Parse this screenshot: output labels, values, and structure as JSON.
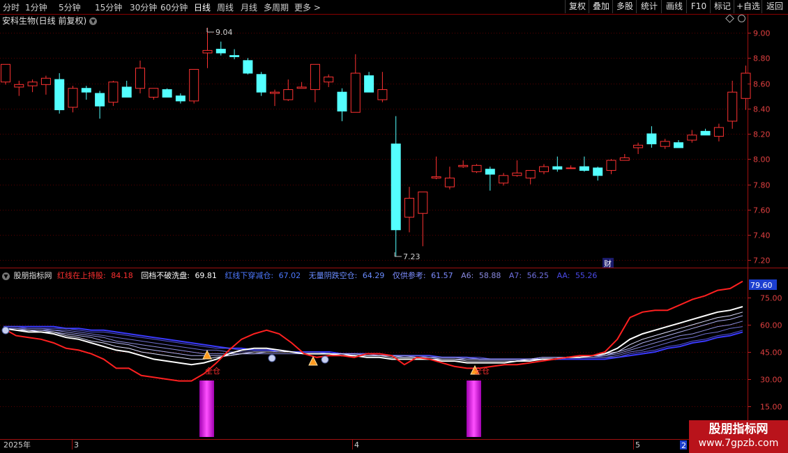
{
  "toolbar": {
    "tabs": [
      "分时",
      "1分钟",
      "5分钟",
      "15分钟",
      "30分钟",
      "60分钟",
      "日线",
      "周线",
      "月线",
      "多周期",
      "更多"
    ],
    "active": "日线",
    "right": [
      "复权",
      "叠加",
      "多股",
      "统计",
      "画线",
      "F10",
      "标记",
      "+自选",
      "返回"
    ]
  },
  "stock": {
    "name": "安科生物(日线 前复权)"
  },
  "price_axis": {
    "ticks": [
      "9.00",
      "8.80",
      "8.60",
      "8.40",
      "8.20",
      "8.00",
      "7.80",
      "7.60",
      "7.40",
      "7.20"
    ]
  },
  "annotations": {
    "high": "9.04",
    "low": "7.23",
    "cai": "财"
  },
  "indicator": {
    "name": "股朋指标网",
    "items": [
      {
        "label": "红线在上持股:",
        "value": "84.18",
        "color": "#ff3030"
      },
      {
        "label": "回档不破洗盘:",
        "value": "69.81",
        "color": "#ffffff"
      },
      {
        "label": "红线下穿减仓:",
        "value": "67.02",
        "color": "#4d79ff"
      },
      {
        "label": "无量阴跌空仓:",
        "value": "64.29",
        "color": "#6a8cff"
      },
      {
        "label": "仅供参考:",
        "value": "61.57",
        "color": "#7d8dff"
      },
      {
        "label": "A6:",
        "value": "58.88",
        "color": "#8a8ae0"
      },
      {
        "label": "A7:",
        "value": "56.25",
        "color": "#7070e0"
      },
      {
        "label": "AA:",
        "value": "55.26",
        "color": "#4a4ae8"
      }
    ],
    "axis_ticks": [
      "75.00",
      "60.00",
      "45.00",
      "30.00",
      "15.00"
    ],
    "current": "79.60",
    "signal_label": "全仓"
  },
  "dates": [
    "2025年",
    "3",
    "4",
    "5",
    "2"
  ],
  "watermark": {
    "line1": "股朋指标网",
    "line2": "www.7gpzb.com"
  },
  "chart_data": [
    {
      "type": "candlestick",
      "title": "安科生物(日线 前复权)",
      "ylim": [
        7.15,
        9.15
      ],
      "candles": [
        {
          "o": 8.61,
          "h": 8.74,
          "l": 8.59,
          "c": 8.75
        },
        {
          "o": 8.57,
          "h": 8.62,
          "l": 8.5,
          "c": 8.59
        },
        {
          "o": 8.58,
          "h": 8.63,
          "l": 8.53,
          "c": 8.61
        },
        {
          "o": 8.59,
          "h": 8.66,
          "l": 8.51,
          "c": 8.64
        },
        {
          "o": 8.63,
          "h": 8.68,
          "l": 8.36,
          "c": 8.39
        },
        {
          "o": 8.41,
          "h": 8.58,
          "l": 8.37,
          "c": 8.56
        },
        {
          "o": 8.56,
          "h": 8.58,
          "l": 8.47,
          "c": 8.53
        },
        {
          "o": 8.52,
          "h": 8.54,
          "l": 8.32,
          "c": 8.42
        },
        {
          "o": 8.45,
          "h": 8.62,
          "l": 8.42,
          "c": 8.61
        },
        {
          "o": 8.57,
          "h": 8.62,
          "l": 8.49,
          "c": 8.49
        },
        {
          "o": 8.56,
          "h": 8.78,
          "l": 8.52,
          "c": 8.72
        },
        {
          "o": 8.49,
          "h": 8.56,
          "l": 8.47,
          "c": 8.56
        },
        {
          "o": 8.55,
          "h": 8.56,
          "l": 8.49,
          "c": 8.49
        },
        {
          "o": 8.5,
          "h": 8.52,
          "l": 8.44,
          "c": 8.46
        },
        {
          "o": 8.46,
          "h": 8.71,
          "l": 8.44,
          "c": 8.71
        },
        {
          "o": 8.84,
          "h": 9.04,
          "l": 8.72,
          "c": 8.86
        },
        {
          "o": 8.87,
          "h": 8.93,
          "l": 8.82,
          "c": 8.84
        },
        {
          "o": 8.82,
          "h": 8.87,
          "l": 8.79,
          "c": 8.81
        },
        {
          "o": 8.78,
          "h": 8.8,
          "l": 8.67,
          "c": 8.68
        },
        {
          "o": 8.67,
          "h": 8.69,
          "l": 8.5,
          "c": 8.53
        },
        {
          "o": 8.52,
          "h": 8.55,
          "l": 8.42,
          "c": 8.53
        },
        {
          "o": 8.47,
          "h": 8.63,
          "l": 8.46,
          "c": 8.55
        },
        {
          "o": 8.56,
          "h": 8.61,
          "l": 8.56,
          "c": 8.57
        },
        {
          "o": 8.55,
          "h": 8.75,
          "l": 8.45,
          "c": 8.75
        },
        {
          "o": 8.61,
          "h": 8.67,
          "l": 8.57,
          "c": 8.65
        },
        {
          "o": 8.53,
          "h": 8.56,
          "l": 8.3,
          "c": 8.38
        },
        {
          "o": 8.37,
          "h": 8.83,
          "l": 8.37,
          "c": 8.68
        },
        {
          "o": 8.66,
          "h": 8.69,
          "l": 8.53,
          "c": 8.53
        },
        {
          "o": 8.47,
          "h": 8.69,
          "l": 8.45,
          "c": 8.55
        },
        {
          "o": 8.12,
          "h": 8.34,
          "l": 7.23,
          "c": 7.44
        },
        {
          "o": 7.54,
          "h": 7.78,
          "l": 7.42,
          "c": 7.69
        },
        {
          "o": 7.57,
          "h": 7.73,
          "l": 7.31,
          "c": 7.74
        },
        {
          "o": 7.85,
          "h": 8.02,
          "l": 7.84,
          "c": 7.86
        },
        {
          "o": 7.78,
          "h": 7.94,
          "l": 7.76,
          "c": 7.85
        },
        {
          "o": 7.94,
          "h": 7.99,
          "l": 7.93,
          "c": 7.95
        },
        {
          "o": 7.9,
          "h": 7.96,
          "l": 7.89,
          "c": 7.95
        },
        {
          "o": 7.92,
          "h": 7.94,
          "l": 7.75,
          "c": 7.88
        },
        {
          "o": 7.81,
          "h": 7.89,
          "l": 7.79,
          "c": 7.87
        },
        {
          "o": 7.87,
          "h": 7.99,
          "l": 7.86,
          "c": 7.89
        },
        {
          "o": 7.85,
          "h": 7.91,
          "l": 7.8,
          "c": 7.91
        },
        {
          "o": 7.9,
          "h": 7.96,
          "l": 7.88,
          "c": 7.94
        },
        {
          "o": 7.94,
          "h": 8.02,
          "l": 7.9,
          "c": 7.92
        },
        {
          "o": 7.93,
          "h": 7.95,
          "l": 7.93,
          "c": 7.93
        },
        {
          "o": 7.94,
          "h": 8.02,
          "l": 7.9,
          "c": 7.91
        },
        {
          "o": 7.93,
          "h": 7.94,
          "l": 7.83,
          "c": 7.87
        },
        {
          "o": 7.91,
          "h": 8.0,
          "l": 7.88,
          "c": 7.99
        },
        {
          "o": 7.99,
          "h": 8.04,
          "l": 7.99,
          "c": 8.01
        },
        {
          "o": 8.09,
          "h": 8.13,
          "l": 8.04,
          "c": 8.11
        },
        {
          "o": 8.2,
          "h": 8.26,
          "l": 8.09,
          "c": 8.12
        },
        {
          "o": 8.1,
          "h": 8.16,
          "l": 8.08,
          "c": 8.14
        },
        {
          "o": 8.13,
          "h": 8.15,
          "l": 8.09,
          "c": 8.09
        },
        {
          "o": 8.15,
          "h": 8.23,
          "l": 8.13,
          "c": 8.19
        },
        {
          "o": 8.22,
          "h": 8.24,
          "l": 8.19,
          "c": 8.19
        },
        {
          "o": 8.18,
          "h": 8.28,
          "l": 8.14,
          "c": 8.25
        },
        {
          "o": 8.3,
          "h": 8.62,
          "l": 8.24,
          "c": 8.53
        },
        {
          "o": 8.48,
          "h": 8.74,
          "l": 8.39,
          "c": 8.68
        }
      ]
    },
    {
      "type": "line",
      "title": "股朋指标网",
      "ylim": [
        8,
        88
      ],
      "series": [
        {
          "name": "红线在上持股",
          "color": "#ff2020",
          "width": 2,
          "values": [
            58,
            54,
            53,
            52,
            50,
            47,
            46,
            44,
            41,
            36,
            36,
            32,
            31,
            30,
            29,
            29,
            33,
            39,
            46,
            52,
            55,
            57,
            55,
            50,
            44,
            42,
            43,
            43,
            42,
            44,
            44,
            43,
            38,
            42,
            41,
            39,
            37,
            36,
            36,
            37,
            38,
            38,
            39,
            40,
            41,
            42,
            43,
            43,
            45,
            52,
            64,
            67,
            68,
            68,
            71,
            74,
            76,
            79,
            80,
            84
          ]
        },
        {
          "name": "回档不破洗盘",
          "color": "#ffffff",
          "width": 2,
          "values": [
            58,
            57,
            56,
            56,
            55,
            53,
            52,
            50,
            48,
            46,
            45,
            43,
            41,
            40,
            39,
            38,
            39,
            41,
            44,
            46,
            47,
            47,
            46,
            45,
            44,
            44,
            44,
            43,
            43,
            42,
            42,
            41,
            41,
            41,
            41,
            40,
            40,
            39,
            39,
            39,
            39,
            40,
            40,
            41,
            41,
            42,
            42,
            43,
            44,
            47,
            52,
            55,
            57,
            59,
            61,
            63,
            65,
            67,
            68,
            70
          ]
        },
        {
          "name": "红线下穿减仓",
          "color": "#e0e0ff",
          "width": 1,
          "values": [
            58,
            57,
            57,
            56,
            56,
            54,
            53,
            51,
            50,
            48,
            47,
            45,
            44,
            43,
            42,
            41,
            41,
            42,
            43,
            44,
            45,
            45,
            45,
            45,
            44,
            44,
            44,
            44,
            43,
            43,
            43,
            42,
            42,
            42,
            41,
            41,
            41,
            40,
            40,
            40,
            40,
            40,
            41,
            41,
            41,
            42,
            42,
            43,
            44,
            45,
            49,
            52,
            54,
            56,
            58,
            60,
            62,
            64,
            65,
            67
          ]
        },
        {
          "name": "无量阴跌空仓",
          "color": "#b0b0f0",
          "width": 1,
          "values": [
            58,
            57,
            57,
            57,
            56,
            55,
            54,
            53,
            51,
            50,
            49,
            47,
            46,
            45,
            44,
            43,
            43,
            43,
            43,
            44,
            44,
            45,
            45,
            45,
            44,
            44,
            44,
            44,
            44,
            43,
            43,
            43,
            42,
            42,
            42,
            41,
            41,
            41,
            41,
            41,
            41,
            41,
            41,
            42,
            42,
            42,
            42,
            43,
            43,
            45,
            47,
            50,
            52,
            54,
            56,
            58,
            60,
            62,
            63,
            65
          ]
        },
        {
          "name": "仅供参考",
          "color": "#9090e0",
          "width": 1,
          "values": [
            58,
            58,
            57,
            57,
            57,
            56,
            55,
            54,
            53,
            51,
            50,
            49,
            48,
            47,
            46,
            45,
            44,
            44,
            44,
            44,
            44,
            44,
            44,
            44,
            44,
            44,
            44,
            44,
            44,
            43,
            43,
            43,
            43,
            42,
            42,
            42,
            42,
            41,
            41,
            41,
            41,
            41,
            41,
            42,
            42,
            42,
            42,
            42,
            43,
            44,
            46,
            48,
            50,
            52,
            54,
            55,
            57,
            59,
            60,
            62
          ]
        },
        {
          "name": "A6",
          "color": "#7070d0",
          "width": 1,
          "values": [
            58,
            58,
            58,
            58,
            57,
            57,
            56,
            55,
            54,
            53,
            52,
            51,
            50,
            49,
            48,
            47,
            46,
            46,
            45,
            45,
            45,
            45,
            45,
            45,
            44,
            44,
            44,
            44,
            44,
            44,
            43,
            43,
            43,
            43,
            42,
            42,
            42,
            42,
            41,
            41,
            41,
            41,
            41,
            42,
            42,
            42,
            42,
            42,
            42,
            43,
            45,
            46,
            48,
            50,
            52,
            53,
            55,
            56,
            58,
            59
          ]
        },
        {
          "name": "A7",
          "color": "#5555e0",
          "width": 1,
          "values": [
            59,
            59,
            58,
            58,
            58,
            58,
            57,
            56,
            56,
            55,
            54,
            53,
            52,
            51,
            50,
            49,
            48,
            47,
            47,
            46,
            46,
            46,
            45,
            45,
            45,
            45,
            44,
            44,
            44,
            44,
            44,
            43,
            43,
            43,
            43,
            42,
            42,
            42,
            42,
            41,
            41,
            41,
            41,
            41,
            41,
            42,
            42,
            42,
            42,
            42,
            44,
            45,
            46,
            48,
            49,
            51,
            52,
            54,
            55,
            57
          ]
        },
        {
          "name": "AA",
          "color": "#3a3aff",
          "width": 2,
          "values": [
            59,
            59,
            59,
            59,
            59,
            58,
            58,
            57,
            57,
            56,
            55,
            54,
            53,
            52,
            51,
            50,
            49,
            48,
            47,
            47,
            46,
            46,
            46,
            45,
            45,
            45,
            45,
            44,
            44,
            44,
            44,
            43,
            43,
            43,
            43,
            42,
            42,
            42,
            41,
            41,
            41,
            41,
            41,
            41,
            41,
            41,
            41,
            41,
            41,
            42,
            43,
            44,
            45,
            47,
            48,
            50,
            51,
            53,
            54,
            56
          ]
        }
      ]
    }
  ]
}
